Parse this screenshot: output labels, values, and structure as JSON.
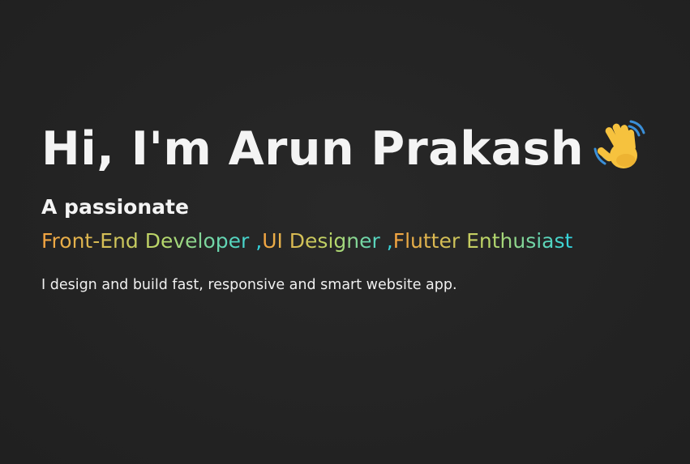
{
  "hero": {
    "heading": "Hi, I'm Arun Prakash",
    "wave_icon": "waving-hand-icon",
    "subtitle": "A passionate",
    "roles": [
      "Front-End Developer ,",
      "UI Designer ,",
      "Flutter Enthusiast"
    ],
    "tagline": "I design and build fast, responsive and smart website app."
  },
  "colors": {
    "background": "#232323",
    "text": "#f4f4f4",
    "gradient_start": "#f4a340",
    "gradient_mid": "#b8d86a",
    "gradient_end": "#2fd3e0"
  }
}
